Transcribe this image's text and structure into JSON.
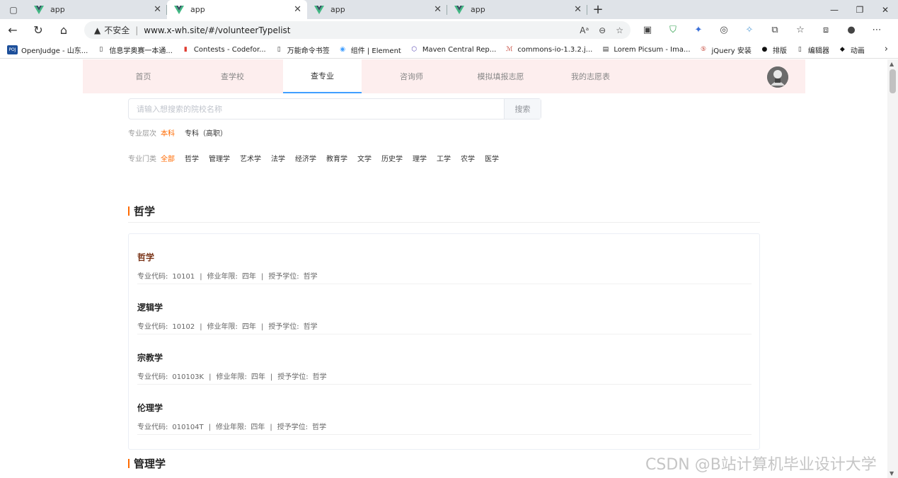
{
  "browser": {
    "tabs": [
      {
        "title": "app",
        "active": false
      },
      {
        "title": "app",
        "active": true
      },
      {
        "title": "app",
        "active": false
      },
      {
        "title": "app",
        "active": false
      }
    ],
    "security_label": "不安全",
    "url": "www.x-wh.site/#/volunteerTypelist",
    "bookmarks": [
      {
        "label": "OpenJudge - 山东...",
        "icon": "openjudge-icon"
      },
      {
        "label": "信息学奥赛一本通...",
        "icon": "page-icon"
      },
      {
        "label": "Contests - Codefor...",
        "icon": "codeforces-icon"
      },
      {
        "label": "万能命令书签",
        "icon": "page-icon"
      },
      {
        "label": "组件 | Element",
        "icon": "element-icon"
      },
      {
        "label": "Maven Central Rep...",
        "icon": "maven-icon"
      },
      {
        "label": "commons-io-1.3.2.j...",
        "icon": "mvn-icon"
      },
      {
        "label": "Lorem Picsum - Ima...",
        "icon": "image-icon"
      },
      {
        "label": "jQuery 安装",
        "icon": "runoob-icon"
      },
      {
        "label": "排版",
        "icon": "github-icon"
      },
      {
        "label": "编辑器",
        "icon": "page-icon"
      },
      {
        "label": "动画",
        "icon": "diamond-icon"
      }
    ]
  },
  "nav": {
    "items": [
      "首页",
      "查学校",
      "查专业",
      "咨询师",
      "模拟填报志愿",
      "我的志愿表"
    ],
    "active_index": 2
  },
  "search": {
    "placeholder": "请输入想搜索的院校名称",
    "button": "搜索"
  },
  "filters": {
    "level": {
      "label": "专业层次",
      "options": [
        "本科",
        "专科（高职）"
      ],
      "selected": "本科"
    },
    "category": {
      "label": "专业门类",
      "options": [
        "全部",
        "哲学",
        "管理学",
        "艺术学",
        "法学",
        "经济学",
        "教育学",
        "文学",
        "历史学",
        "理学",
        "工学",
        "农学",
        "医学"
      ],
      "selected": "全部"
    }
  },
  "sections": [
    {
      "title": "哲学",
      "majors": [
        {
          "name": "哲学",
          "code_label": "专业代码:",
          "code": "10101",
          "years_label": "修业年限:",
          "years": "四年",
          "degree_label": "授予学位:",
          "degree": "哲学"
        },
        {
          "name": "逻辑学",
          "code_label": "专业代码:",
          "code": "10102",
          "years_label": "修业年限:",
          "years": "四年",
          "degree_label": "授予学位:",
          "degree": "哲学"
        },
        {
          "name": "宗教学",
          "code_label": "专业代码:",
          "code": "010103K",
          "years_label": "修业年限:",
          "years": "四年",
          "degree_label": "授予学位:",
          "degree": "哲学"
        },
        {
          "name": "伦理学",
          "code_label": "专业代码:",
          "code": "010104T",
          "years_label": "修业年限:",
          "years": "四年",
          "degree_label": "授予学位:",
          "degree": "哲学"
        }
      ]
    },
    {
      "title": "管理学",
      "majors": []
    }
  ],
  "watermark": "CSDN @B站计算机毕业设计大学",
  "colors": {
    "accent": "#ff6a00",
    "nav_bg": "#fdeeee",
    "active_underline": "#409eff"
  }
}
